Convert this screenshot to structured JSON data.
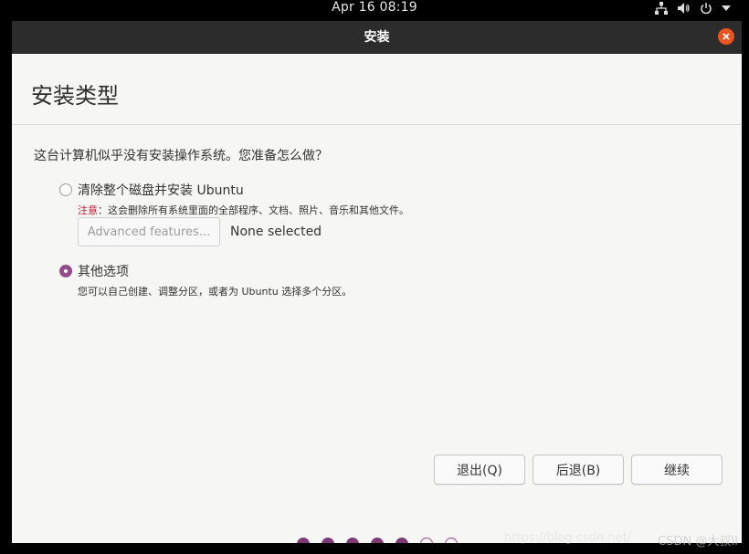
{
  "topbar": {
    "clock": "Apr 16  08:19",
    "icons": [
      "network-icon",
      "volume-icon",
      "power-icon",
      "menu-arrow-icon"
    ]
  },
  "window": {
    "title": "安装",
    "close_icon": "close-icon",
    "accent": "#e95420"
  },
  "page": {
    "title": "安装类型",
    "question": "这台计算机似乎没有安装操作系统。您准备怎么做？"
  },
  "options": [
    {
      "label": "清除整个磁盘并安装 Ubuntu",
      "selected": false,
      "note_warning": "注意",
      "note_text": "：这会删除所有系统里面的全部程序、文档、照片、音乐和其他文件。",
      "advanced_button": "Advanced features...",
      "advanced_status": "None selected"
    },
    {
      "label": "其他选项",
      "selected": true,
      "description": "您可以自己创建、调整分区，或者为 Ubuntu 选择多个分区。"
    }
  ],
  "buttons": {
    "quit": "退出(Q)",
    "back": "后退(B)",
    "continue": "继续"
  },
  "progress": {
    "total_steps": 7,
    "completed_steps": 5,
    "color": "#924d8b"
  },
  "watermark": {
    "url": "https://blog.csdn.net/",
    "author": "CSDN @大叔II"
  }
}
